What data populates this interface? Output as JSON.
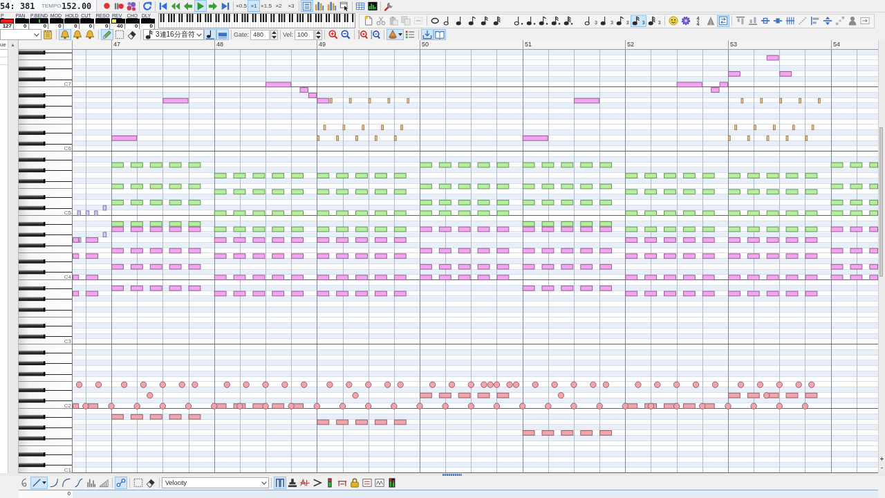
{
  "transport_toolbar": {
    "counter": {
      "position": "54: 381",
      "tempo_label": "TEMPO",
      "tempo": "152.00"
    },
    "groups": [
      [
        {
          "kind": "record",
          "on": false
        },
        {
          "kind": "recordpause",
          "on": false
        },
        {
          "kind": "midiin",
          "on": false
        }
      ],
      [
        {
          "kind": "loop",
          "on": false
        }
      ],
      [
        {
          "kind": "skipstart",
          "on": false
        },
        {
          "kind": "rewind",
          "on": false
        },
        {
          "kind": "stepback",
          "on": false
        },
        {
          "kind": "play",
          "on": true
        },
        {
          "kind": "stepforward",
          "on": false
        },
        {
          "kind": "skipend",
          "on": false
        }
      ],
      [
        {
          "kind": "speed",
          "label": "×0.5",
          "selected": false
        },
        {
          "kind": "speed",
          "label": "×1",
          "selected": true
        },
        {
          "kind": "speed",
          "label": "×1.5",
          "selected": false
        },
        {
          "kind": "speed",
          "label": "×2",
          "selected": false
        },
        {
          "kind": "speed",
          "label": "×3",
          "selected": false
        }
      ],
      [
        {
          "kind": "listview",
          "on": true
        },
        {
          "kind": "trackview",
          "on": false
        },
        {
          "kind": "trackview",
          "on": false
        },
        {
          "kind": "cursorwin",
          "on": false
        }
      ],
      [
        {
          "kind": "table",
          "on": false
        },
        {
          "kind": "meter",
          "on": false
        }
      ],
      [
        {
          "kind": "wrench",
          "on": false
        }
      ]
    ]
  },
  "controllers": [
    {
      "label": "P",
      "value": "127",
      "level": 1,
      "kind": "fill",
      "color": "#e81c1c"
    },
    {
      "label": "PAN",
      "value": "0",
      "level": 0,
      "kind": "fill"
    },
    {
      "label": "P.BEND",
      "value": "0",
      "level": 0.5,
      "kind": "center",
      "color": "#3cc03c"
    },
    {
      "label": "MOD",
      "value": "0",
      "level": 0,
      "kind": "fill"
    },
    {
      "label": "HOLD",
      "value": "0",
      "level": 0,
      "kind": "fill"
    },
    {
      "label": "CUT",
      "value": "0",
      "level": 0,
      "kind": "fill"
    },
    {
      "label": "RESO",
      "value": "0",
      "level": 0,
      "kind": "fill"
    },
    {
      "label": "REV",
      "value": "40",
      "level": 0.31,
      "kind": "fill",
      "color": "#f2ee5a"
    },
    {
      "label": "CHO",
      "value": "0",
      "level": 0,
      "kind": "fill"
    },
    {
      "label": "DLY",
      "value": "0",
      "level": 0,
      "kind": "fill"
    }
  ],
  "edit_toolbar": {
    "groups": [
      [
        {
          "kind": "newpage",
          "disabled": false
        },
        {
          "kind": "cut",
          "disabled": true
        },
        {
          "kind": "paste",
          "disabled": true
        },
        {
          "kind": "copy",
          "disabled": true
        },
        {
          "kind": "clearbox",
          "disabled": true
        }
      ],
      [
        {
          "kind": "whole",
          "selected": false
        },
        {
          "kind": "half",
          "selected": false
        },
        {
          "kind": "quarter",
          "selected": false
        },
        {
          "kind": "eighth",
          "selected": false
        },
        {
          "kind": "sixteenth",
          "selected": false
        },
        {
          "kind": "thirtysecond",
          "selected": false
        },
        {
          "kind": "dottedhalf",
          "selected": false
        },
        {
          "kind": "dottedquarter",
          "selected": false
        },
        {
          "kind": "dottedeighth",
          "selected": false
        },
        {
          "kind": "dottedsixteenth",
          "selected": false
        },
        {
          "kind": "dottedthirtysecond",
          "selected": false
        },
        {
          "kind": "triplethalf",
          "label": "3",
          "selected": false
        },
        {
          "kind": "tripletquarter",
          "label": "3",
          "selected": false
        },
        {
          "kind": "tripleteighth",
          "label": "3",
          "selected": false
        },
        {
          "kind": "tripletsixteenth",
          "label": "3",
          "selected": true
        },
        {
          "kind": "tripletthirtysecond",
          "label": "3",
          "selected": false
        }
      ],
      [
        {
          "kind": "smiley",
          "on": false
        },
        {
          "kind": "gear",
          "on": false
        },
        {
          "kind": "timesig",
          "numerator": "4",
          "denominator": "4"
        },
        {
          "kind": "metronome",
          "on": false
        },
        {
          "kind": "swap",
          "on": true
        }
      ],
      [
        {
          "kind": "aligntop",
          "on": false
        },
        {
          "kind": "alignbottom",
          "on": false
        },
        {
          "kind": "split",
          "on": false
        },
        {
          "kind": "merge",
          "on": false
        },
        {
          "kind": "comb",
          "on": false
        },
        {
          "kind": "slant",
          "on": false
        },
        {
          "kind": "alignleft",
          "on": false
        },
        {
          "kind": "center",
          "on": false
        },
        {
          "kind": "scatter",
          "on": false
        },
        {
          "kind": "person",
          "on": false
        },
        {
          "kind": "boxarrow",
          "on": false
        }
      ]
    ]
  },
  "tool_toolbar": {
    "groups": [
      [
        {
          "kind": "trackselect"
        },
        {
          "kind": "notepad",
          "on": false
        }
      ],
      [
        {
          "kind": "bell",
          "on": true
        },
        {
          "kind": "bell",
          "on": false
        },
        {
          "kind": "bell",
          "on": false
        }
      ],
      [
        {
          "kind": "pencil",
          "on": true
        },
        {
          "kind": "select",
          "on": false
        },
        {
          "kind": "eraser",
          "on": false
        }
      ],
      [
        {
          "kind": "lengthselect",
          "value": "3連16分音符"
        },
        {
          "kind": "noteline",
          "on": true
        },
        {
          "kind": "bar",
          "on": true
        }
      ],
      [
        {
          "kind": "spinfield",
          "label": "Gate:",
          "value": "480"
        }
      ],
      [
        {
          "kind": "spinfield",
          "label": "Vel:",
          "value": "100"
        }
      ],
      [
        {
          "kind": "zoomin",
          "on": false
        },
        {
          "kind": "zoomout",
          "on": false
        }
      ],
      [
        {
          "kind": "vzoomin",
          "on": false
        },
        {
          "kind": "vzoomout",
          "on": false
        }
      ],
      [
        {
          "kind": "cone",
          "on": true
        },
        {
          "kind": "checklist",
          "on": false
        }
      ],
      [
        {
          "kind": "tray",
          "on": true
        },
        {
          "kind": "book",
          "on": true
        }
      ]
    ]
  },
  "track_list": {
    "header": "ue",
    "scroll_up": "▲"
  },
  "piano_roll": {
    "measure_numbers": [
      "47",
      "48",
      "49",
      "50",
      "51",
      "52",
      "53",
      "54"
    ],
    "octave_labels": [
      "C7",
      "C6",
      "C5",
      "C4",
      "C3",
      "C2",
      "C1"
    ]
  },
  "vertical_zoom": [
    "+",
    "-"
  ],
  "bottom_toolbar": {
    "groups": [
      [
        {
          "kind": "freehand",
          "on": false
        },
        {
          "kind": "line",
          "on": true
        },
        {
          "kind": "curve",
          "on": false
        },
        {
          "kind": "arc",
          "on": false
        },
        {
          "kind": "scurve",
          "on": false
        },
        {
          "kind": "spikes",
          "on": false
        },
        {
          "kind": "ramp",
          "on": false
        }
      ],
      [
        {
          "kind": "nodes",
          "on": true
        }
      ],
      [
        {
          "kind": "select",
          "on": false
        },
        {
          "kind": "eraser",
          "on": false
        }
      ],
      [
        {
          "kind": "controllerselect",
          "value": "Velocity"
        }
      ],
      [
        {
          "kind": "bracket",
          "on": true
        },
        {
          "kind": "stamp",
          "on": false
        },
        {
          "kind": "strike",
          "on": false
        },
        {
          "kind": "chevron",
          "on": false
        },
        {
          "kind": "meterbar",
          "on": false
        },
        {
          "kind": "frame",
          "on": false
        },
        {
          "kind": "lock",
          "on": false
        },
        {
          "kind": "form",
          "on": false
        },
        {
          "kind": "wavebox",
          "on": false
        },
        {
          "kind": "levelmeter",
          "on": false
        }
      ]
    ]
  },
  "velocity_pane": {
    "scale_label": "0"
  }
}
